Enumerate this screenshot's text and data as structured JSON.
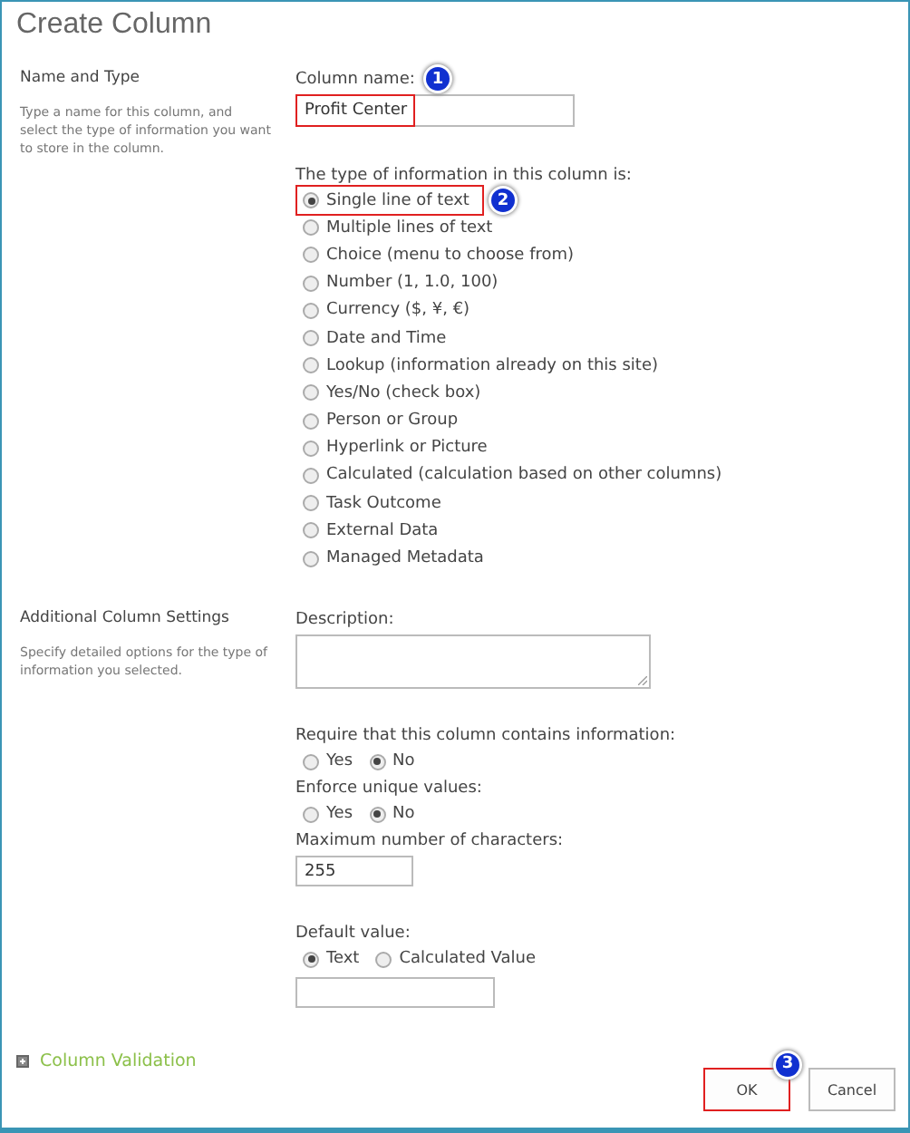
{
  "window": {
    "title": "Create Column"
  },
  "sections": [
    {
      "heading": "Name and Type",
      "description": "Type a name for this column, and select the type of information you want to store in the column."
    },
    {
      "heading": "Additional Column Settings",
      "description": "Specify detailed options for the type of information you selected."
    }
  ],
  "column_name": {
    "label": "Column name:",
    "value": "Profit Center",
    "callout": "1"
  },
  "type": {
    "label": "The type of information in this column is:",
    "options": [
      {
        "label": "Single line of text",
        "selected": true,
        "callout": "2"
      },
      {
        "label": "Multiple lines of text",
        "selected": false
      },
      {
        "label": "Choice (menu to choose from)",
        "selected": false
      },
      {
        "label": "Number (1, 1.0, 100)",
        "selected": false
      },
      {
        "label": "Currency ($, ¥, €)",
        "selected": false
      },
      {
        "label": "Date and Time",
        "selected": false
      },
      {
        "label": "Lookup (information already on this site)",
        "selected": false
      },
      {
        "label": "Yes/No (check box)",
        "selected": false
      },
      {
        "label": "Person or Group",
        "selected": false
      },
      {
        "label": "Hyperlink or Picture",
        "selected": false
      },
      {
        "label": "Calculated (calculation based on other columns)",
        "selected": false
      },
      {
        "label": "Task Outcome",
        "selected": false
      },
      {
        "label": "External Data",
        "selected": false
      },
      {
        "label": "Managed Metadata",
        "selected": false
      }
    ]
  },
  "description": {
    "label": "Description:"
  },
  "require": {
    "label": "Require that this column contains information:",
    "options": [
      {
        "label": "Yes",
        "selected": false
      },
      {
        "label": "No",
        "selected": true
      }
    ]
  },
  "unique": {
    "label": "Enforce unique values:",
    "options": [
      {
        "label": "Yes",
        "selected": false
      },
      {
        "label": "No",
        "selected": true
      }
    ]
  },
  "max_chars": {
    "label": "Maximum number of characters:",
    "value": "255"
  },
  "default_value": {
    "label": "Default value:",
    "options": [
      {
        "label": "Text",
        "selected": true
      },
      {
        "label": "Calculated Value",
        "selected": false
      }
    ]
  },
  "column_validation": {
    "label": "Column Validation",
    "expanded": false
  },
  "buttons": [
    {
      "label": "OK",
      "callout": "3"
    },
    {
      "label": "Cancel"
    }
  ]
}
